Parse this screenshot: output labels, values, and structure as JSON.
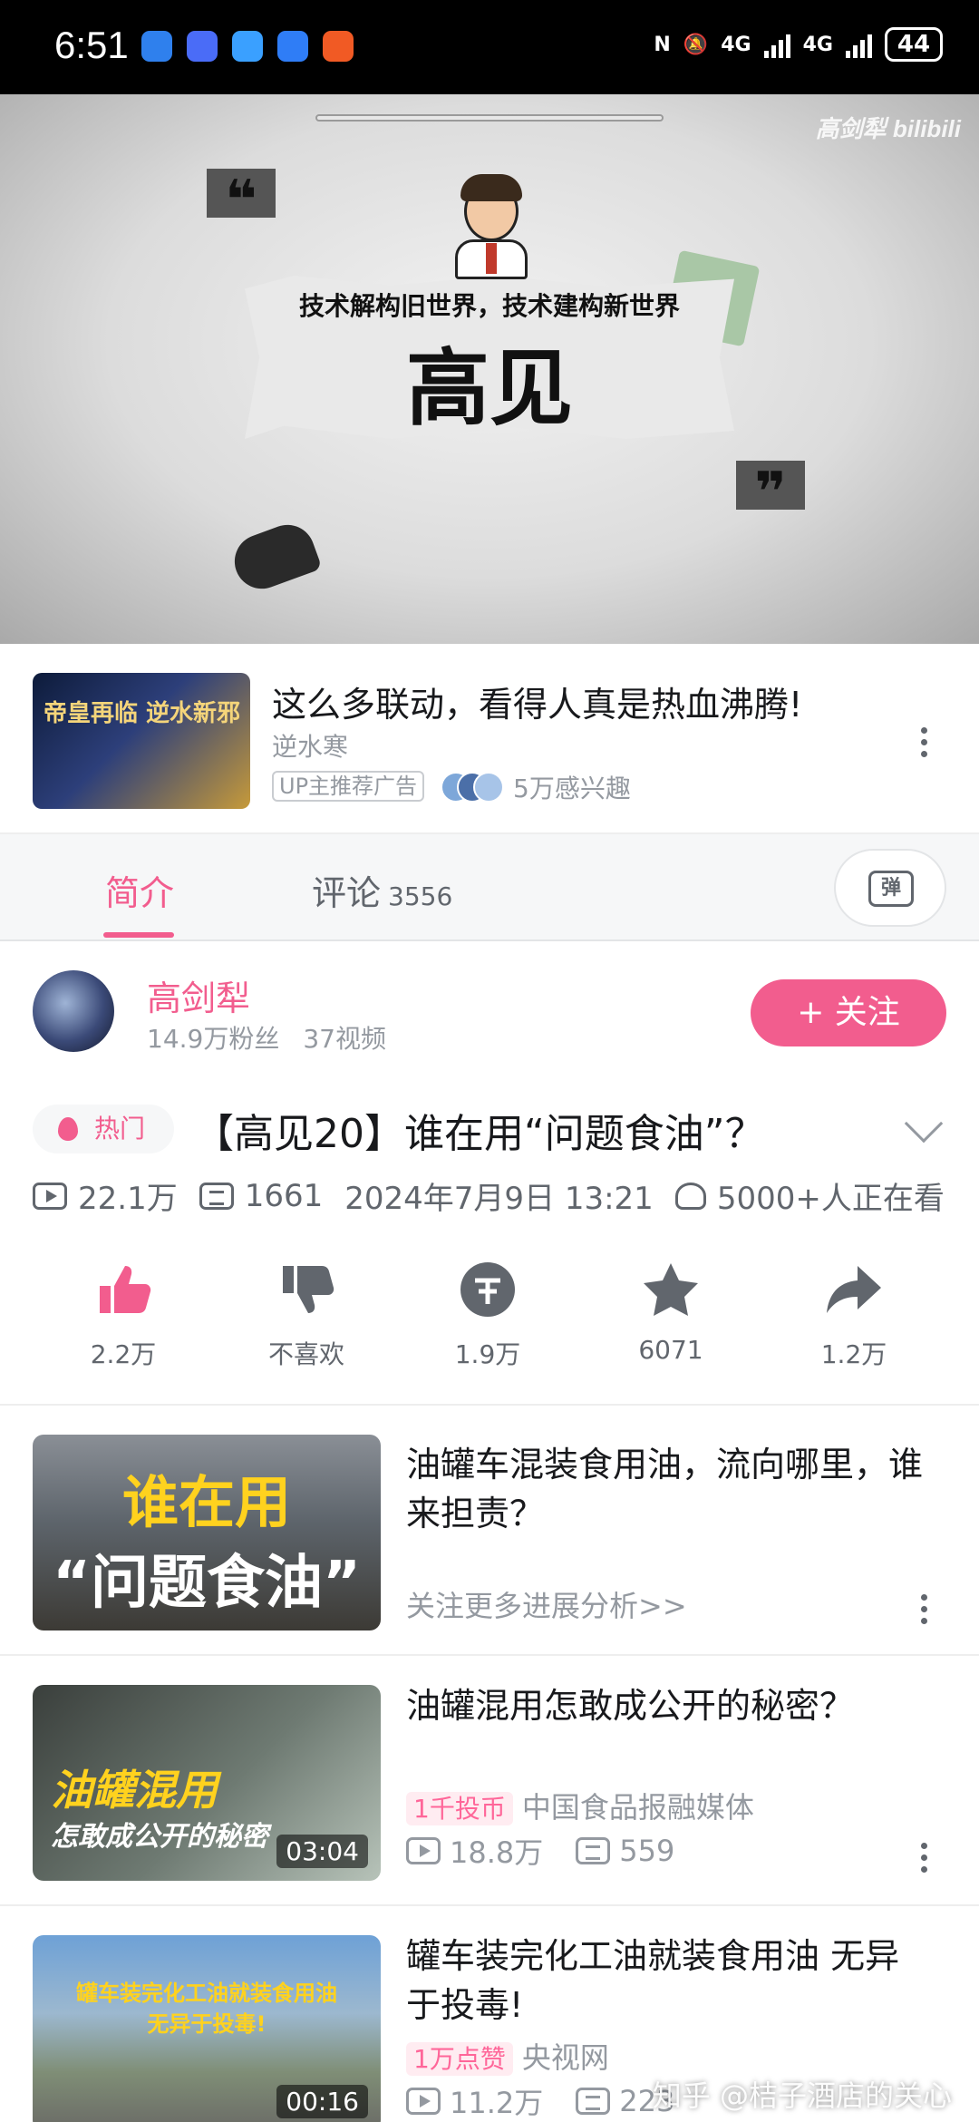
{
  "status_bar": {
    "time": "6:51",
    "network_1": "4G",
    "network_2": "4G",
    "battery": "44",
    "app_icon_colors": [
      "#2f80ed",
      "#4a6cf7",
      "#3aa0ff",
      "#2f7df6",
      "#f15a24"
    ]
  },
  "video": {
    "slogan": "技术解构旧世界，技术建构新世界",
    "big_title": "高见",
    "watermark": "高剑犁 bilibili"
  },
  "ad": {
    "thumb_text": "帝皇再临 逆水新邪",
    "title": "这么多联动，看得人真是热血沸腾!",
    "subtitle": "逆水寒",
    "badge": "UP主推荐广告",
    "interest": "5万感兴趣"
  },
  "tabs": {
    "intro": "简介",
    "comments": "评论",
    "comments_count": "3556",
    "danmaku_icon": "弹"
  },
  "uploader": {
    "name": "高剑犁",
    "fans": "14.9万粉丝",
    "videos": "37视频",
    "follow_label": "+ 关注"
  },
  "video_info": {
    "hot_label": "热门",
    "title": "【高见20】谁在用“问题食油”？",
    "plays": "22.1万",
    "danmaku": "1661",
    "date": "2024年7月9日 13:21",
    "watching": "5000+人正在看"
  },
  "actions": [
    {
      "name": "like",
      "label": "2.2万"
    },
    {
      "name": "dislike",
      "label": "不喜欢"
    },
    {
      "name": "coin",
      "label": "1.9万"
    },
    {
      "name": "favorite",
      "label": "6071"
    },
    {
      "name": "share",
      "label": "1.2万"
    }
  ],
  "recommendations": [
    {
      "thumb_line1": "谁在用",
      "thumb_line2": "“问题食油”",
      "title": "油罐车混装食用油，流向哪里，谁来担责？",
      "note": "关注更多进展分析>>"
    },
    {
      "thumb_line1": "油罐混用",
      "thumb_line2": "怎敢成公开的秘密",
      "duration": "03:04",
      "title": "油罐混用怎敢成公开的秘密？",
      "tag": "1千投币",
      "source": "中国食品报融媒体",
      "plays": "18.8万",
      "danmaku": "559"
    },
    {
      "thumb_line1": "罐车装完化工油就装食用油",
      "thumb_line2": "无异于投毒!",
      "duration": "00:16",
      "title": "罐车装完化工油就装食用油 无异于投毒!",
      "tag": "1万点赞",
      "source": "央视网",
      "plays": "11.2万",
      "danmaku": "223"
    }
  ],
  "overlay_watermark": "知乎 @桔子酒店的关心",
  "colors": {
    "accent": "#f25d8e",
    "text": "#18191c",
    "muted": "#9499a0"
  }
}
